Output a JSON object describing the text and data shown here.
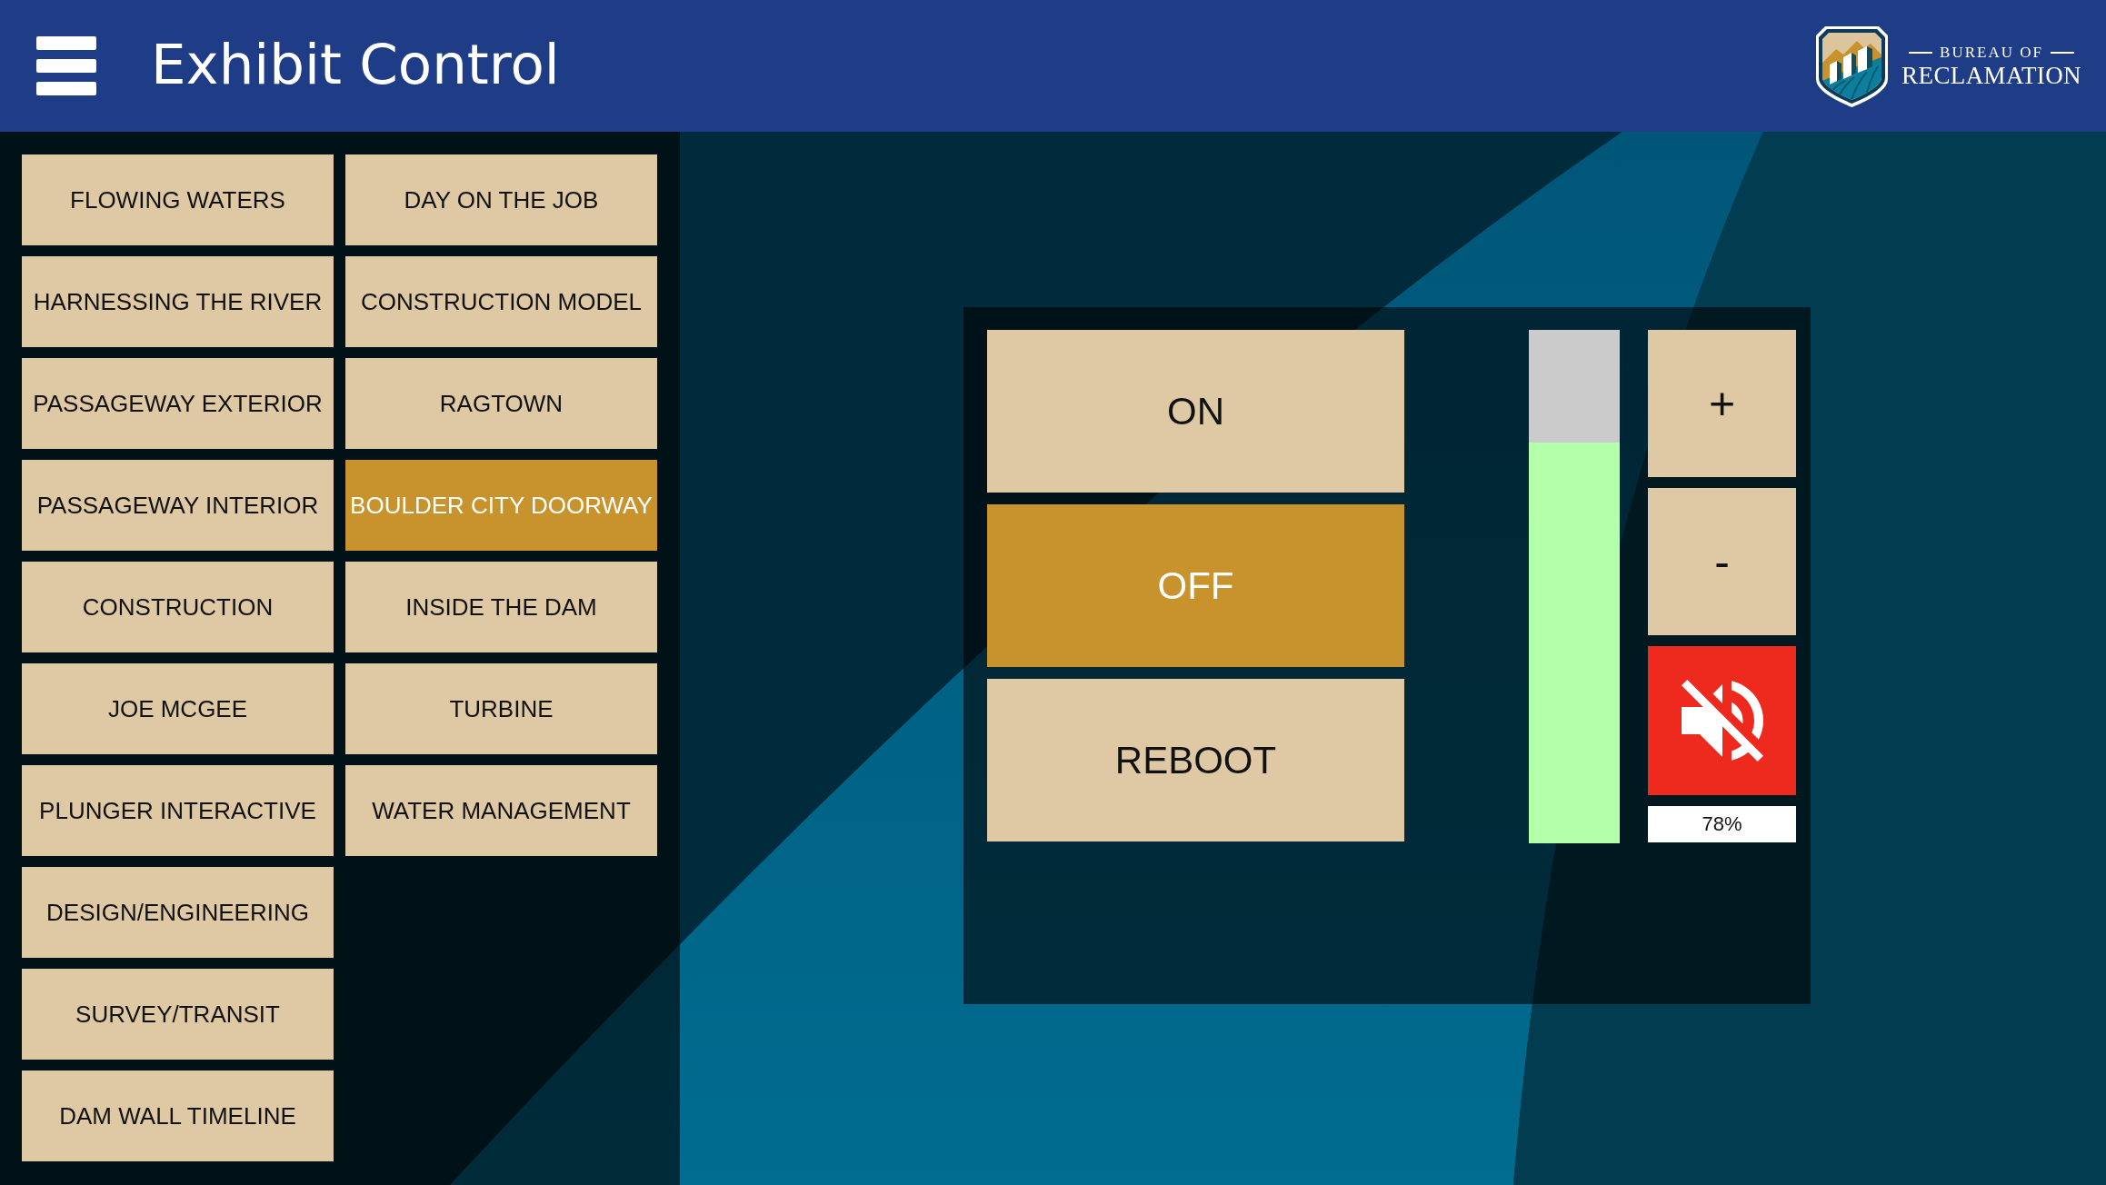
{
  "header": {
    "title": "Exhibit Control",
    "logo": {
      "line_1": "BUREAU OF",
      "line_2": "RECLAMATION"
    }
  },
  "exhibits": [
    {
      "label": "FLOWING WATERS",
      "selected": false
    },
    {
      "label": "HARNESSING THE RIVER",
      "selected": false
    },
    {
      "label": "PASSAGEWAY EXTERIOR",
      "selected": false
    },
    {
      "label": "PASSAGEWAY INTERIOR",
      "selected": false
    },
    {
      "label": "CONSTRUCTION",
      "selected": false
    },
    {
      "label": "JOE MCGEE",
      "selected": false
    },
    {
      "label": "PLUNGER INTERACTIVE",
      "selected": false
    },
    {
      "label": "DESIGN/ENGINEERING",
      "selected": false
    },
    {
      "label": "SURVEY/TRANSIT",
      "selected": false
    },
    {
      "label": "DAM WALL TIMELINE",
      "selected": false
    },
    {
      "label": "DAY ON THE JOB",
      "selected": false
    },
    {
      "label": "CONSTRUCTION MODEL",
      "selected": false
    },
    {
      "label": "RAGTOWN",
      "selected": false
    },
    {
      "label": "BOULDER CITY DOORWAY",
      "selected": true
    },
    {
      "label": "INSIDE THE DAM",
      "selected": false
    },
    {
      "label": "TURBINE",
      "selected": false
    },
    {
      "label": "WATER MANAGEMENT",
      "selected": false
    }
  ],
  "power_modes": [
    {
      "label": "ON",
      "selected": false
    },
    {
      "label": "OFF",
      "selected": true
    },
    {
      "label": "REBOOT",
      "selected": false
    }
  ],
  "volume": {
    "level": 0.78,
    "increase_label": "+",
    "decrease_label": "-",
    "muted": true,
    "reading": "78%"
  }
}
